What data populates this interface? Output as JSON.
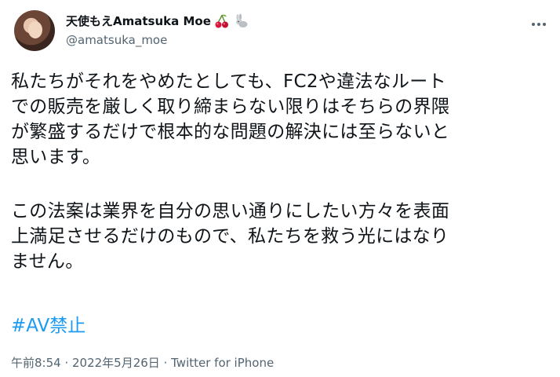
{
  "author": {
    "display_name": "天使もえAmatsuka Moe",
    "handle": "@amatsuka_moe",
    "emoji_1": "cherry-icon",
    "emoji_2": "rabbit-icon"
  },
  "tweet": {
    "paragraph_1": [
      "私たちがそれをやめたとしても、FC2や違法なルート",
      "での販売を厳しく取り締まらない限りはそちらの界隈",
      "が繁盛するだけで根本的な問題の解決には至らないと",
      "思います。"
    ],
    "paragraph_2": [
      "この法案は業界を自分の思い通りにしたい方々を表面",
      "上満足させるだけのもので、私たちを救う光にはなり",
      "ません。"
    ],
    "hashtag": "#AV禁止"
  },
  "meta": {
    "time": "午前8:54",
    "separator": " · ",
    "date": "2022年5月26日",
    "source": "Twitter for iPhone"
  },
  "colors": {
    "link": "#1d9bf0",
    "secondary_text": "#536471"
  }
}
